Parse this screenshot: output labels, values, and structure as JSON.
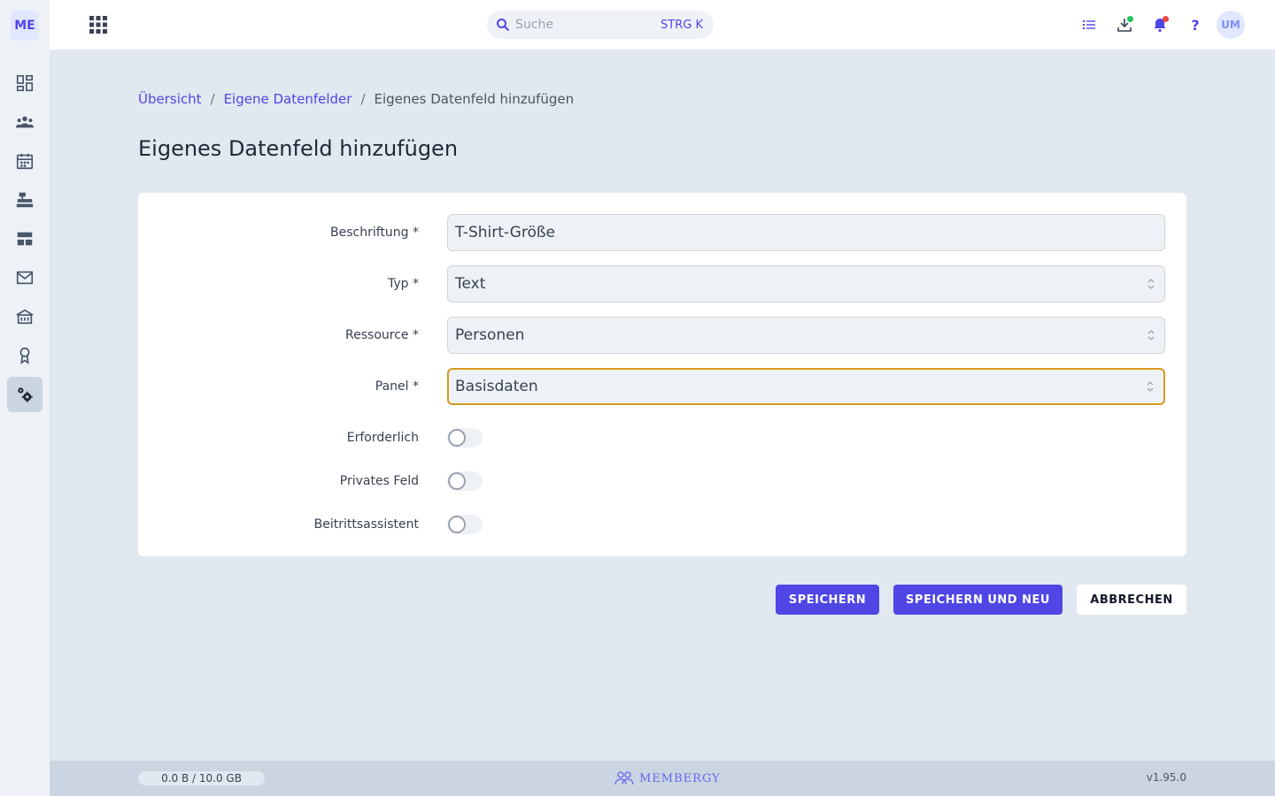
{
  "app": {
    "logo_text": "ME",
    "brand_name": "MEMBERGY",
    "accent_color": "#4f46e5"
  },
  "sidebar": {
    "items": [
      {
        "icon": "dashboard-icon"
      },
      {
        "icon": "people-icon"
      },
      {
        "icon": "calendar-icon"
      },
      {
        "icon": "cash-register-icon"
      },
      {
        "icon": "table-icon"
      },
      {
        "icon": "mail-icon"
      },
      {
        "icon": "building-icon"
      },
      {
        "icon": "award-icon"
      },
      {
        "icon": "settings-icon",
        "active": true
      }
    ]
  },
  "topbar": {
    "search_placeholder": "Suche",
    "search_shortcut": "STRG K",
    "help_label": "?",
    "avatar_initials": "UM",
    "notification_dots": {
      "downloads": "#22c55e",
      "notifications": "#ef4444"
    }
  },
  "breadcrumb": {
    "items": [
      "Übersicht",
      "Eigene Datenfelder"
    ],
    "current": "Eigenes Datenfeld hinzufügen",
    "separator": "/"
  },
  "page": {
    "title": "Eigenes Datenfeld hinzufügen"
  },
  "form": {
    "label_field": {
      "label": "Beschriftung *",
      "value": "T-Shirt-Größe"
    },
    "type_field": {
      "label": "Typ *",
      "value": "Text"
    },
    "resource_field": {
      "label": "Ressource *",
      "value": "Personen"
    },
    "panel_field": {
      "label": "Panel *",
      "value": "Basisdaten",
      "focused": true
    },
    "required_toggle": {
      "label": "Erforderlich",
      "on": false
    },
    "private_toggle": {
      "label": "Privates Feld",
      "on": false
    },
    "wizard_toggle": {
      "label": "Beitrittsassistent",
      "on": false
    }
  },
  "actions": {
    "save": "SPEICHERN",
    "save_new": "SPEICHERN UND NEU",
    "cancel": "ABBRECHEN"
  },
  "footer": {
    "storage": "0.0 B / 10.0 GB",
    "version": "v1.95.0"
  }
}
